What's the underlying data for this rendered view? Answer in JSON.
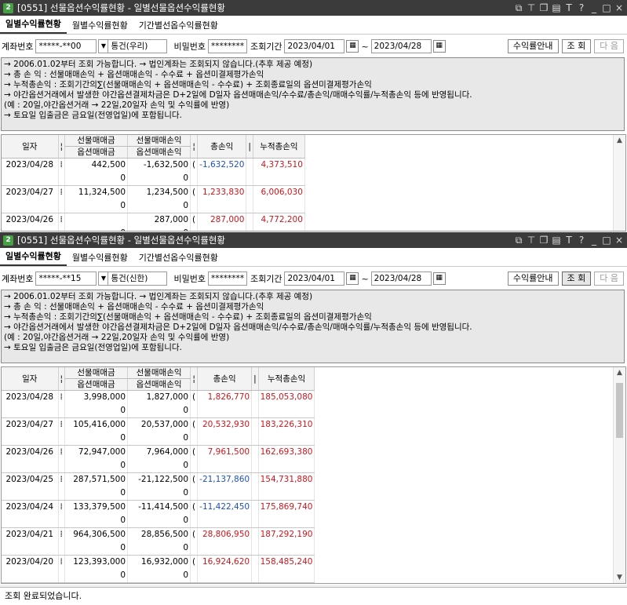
{
  "windows": [
    {
      "badge": "2",
      "title": "[0551] 선물옵션수익률현황 - 일별선물옵션수익률현황",
      "tabs": [
        "일별수익률현황",
        "월별수익률현황",
        "기간별선옵수익률현황"
      ],
      "account_label": "계좌번호",
      "account_value": "*****-**00",
      "account_type": "통건(우리)",
      "password_label": "비밀번호",
      "password_value": "********",
      "period_label": "조회기간",
      "date_from": "2023/04/01",
      "date_sep": "~",
      "date_to": "2023/04/28",
      "btn_guide": "수익률안내",
      "btn_query": "조 회",
      "btn_next": "다 음",
      "notice": [
        "→ 2006.01.02부터 조회 가능합니다. → 법인계좌는 조회되지 않습니다.(추후 제공 예정)",
        "→ 총   손   익 : 선물매매손익 + 옵션매매손익 - 수수료 + 옵션미결제평가손익",
        "→ 누적총손익 : 조회기간의∑(선물매매손익 + 옵션매매손익 - 수수료) + 조회종료일의 옵션미결제평가손익",
        "→ 야간옵션거래에서 발생한 야간옵션결제차금은 D+2일에 D일자 옵션매매손익/수수료/총손익/매매수익률/누적총손익 등에 반영됩니다.",
        "    (예 : 20일,야간옵션거래 → 22일,20일자 손익 및 수익률에 반영)",
        "→ 토요일 입출금은 금요일(전영업일)에 포함됩니다."
      ],
      "headers": {
        "date": "일자",
        "futures_amount": "선물매매금",
        "option_amount": "옵션매매금",
        "futures_pnl": "선물매매손익",
        "option_pnl": "옵션매매손익",
        "total_pnl": "총손익",
        "cum_pnl": "누적총손익"
      },
      "rows": [
        {
          "date": "2023/04/28",
          "fut_amt": "442,500",
          "opt_amt": "0",
          "fut_pnl": "-1,632,500",
          "opt_pnl": "0",
          "total": "-1,632,520",
          "total_color": "blue",
          "cum": "4,373,510",
          "cum_color": "red"
        },
        {
          "date": "2023/04/27",
          "fut_amt": "11,324,500",
          "opt_amt": "0",
          "fut_pnl": "1,234,500",
          "opt_pnl": "0",
          "total": "1,233,830",
          "total_color": "red",
          "cum": "6,006,030",
          "cum_color": "red"
        },
        {
          "date": "2023/04/26",
          "fut_amt": "",
          "opt_amt": "0",
          "fut_pnl": "287,000",
          "opt_pnl": "0",
          "total": "287,000",
          "total_color": "red",
          "cum": "4,772,200",
          "cum_color": "red"
        }
      ]
    },
    {
      "badge": "2",
      "title": "[0551] 선물옵션수익률현황 - 일별선물옵션수익률현황",
      "tabs": [
        "일별수익률현황",
        "월별수익률현황",
        "기간별선옵수익률현황"
      ],
      "account_label": "계좌번호",
      "account_value": "*****-**15",
      "account_type": "통건(신한)",
      "password_label": "비밀번호",
      "password_value": "********",
      "period_label": "조회기간",
      "date_from": "2023/04/01",
      "date_sep": "~",
      "date_to": "2023/04/28",
      "btn_guide": "수익률안내",
      "btn_query": "조 회",
      "btn_next": "다 음",
      "notice": [
        "→ 2006.01.02부터 조회 가능합니다. → 법인계좌는 조회되지 않습니다.(추후 제공 예정)",
        "→ 총   손   익 : 선물매매손익 + 옵션매매손익 - 수수료 + 옵션미결제평가손익",
        "→ 누적총손익 : 조회기간의∑(선물매매손익 + 옵션매매손익 - 수수료) + 조회종료일의 옵션미결제평가손익",
        "→ 야간옵션거래에서 발생한 야간옵션결제차금은 D+2일에 D일자 옵션매매손익/수수료/총손익/매매수익률/누적총손익 등에 반영됩니다.",
        "    (예 : 20일,야간옵션거래 → 22일,20일자 손익 및 수익률에 반영)",
        "→ 토요일 입출금은 금요일(전영업일)에 포함됩니다."
      ],
      "headers": {
        "date": "일자",
        "futures_amount": "선물매매금",
        "option_amount": "옵션매매금",
        "futures_pnl": "선물매매손익",
        "option_pnl": "옵션매매손익",
        "total_pnl": "총손익",
        "cum_pnl": "누적총손익"
      },
      "rows": [
        {
          "date": "2023/04/28",
          "fut_amt": "3,998,000",
          "opt_amt": "0",
          "fut_pnl": "1,827,000",
          "opt_pnl": "0",
          "total": "1,826,770",
          "total_color": "red",
          "cum": "185,053,080",
          "cum_color": "red"
        },
        {
          "date": "2023/04/27",
          "fut_amt": "105,416,000",
          "opt_amt": "0",
          "fut_pnl": "20,537,000",
          "opt_pnl": "0",
          "total": "20,532,930",
          "total_color": "red",
          "cum": "183,226,310",
          "cum_color": "red"
        },
        {
          "date": "2023/04/26",
          "fut_amt": "72,947,000",
          "opt_amt": "0",
          "fut_pnl": "7,964,000",
          "opt_pnl": "0",
          "total": "7,961,500",
          "total_color": "red",
          "cum": "162,693,380",
          "cum_color": "red"
        },
        {
          "date": "2023/04/25",
          "fut_amt": "287,571,500",
          "opt_amt": "0",
          "fut_pnl": "-21,122,500",
          "opt_pnl": "0",
          "total": "-21,137,860",
          "total_color": "blue",
          "cum": "154,731,880",
          "cum_color": "red"
        },
        {
          "date": "2023/04/24",
          "fut_amt": "133,379,500",
          "opt_amt": "0",
          "fut_pnl": "-11,414,500",
          "opt_pnl": "0",
          "total": "-11,422,450",
          "total_color": "blue",
          "cum": "175,869,740",
          "cum_color": "red"
        },
        {
          "date": "2023/04/21",
          "fut_amt": "964,306,500",
          "opt_amt": "0",
          "fut_pnl": "28,856,500",
          "opt_pnl": "0",
          "total": "28,806,950",
          "total_color": "red",
          "cum": "187,292,190",
          "cum_color": "red"
        },
        {
          "date": "2023/04/20",
          "fut_amt": "123,393,000",
          "opt_amt": "0",
          "fut_pnl": "16,932,000",
          "opt_pnl": "0",
          "total": "16,924,620",
          "total_color": "red",
          "cum": "158,485,240",
          "cum_color": "red"
        }
      ]
    }
  ],
  "status_text": "조회 완료되었습니다."
}
